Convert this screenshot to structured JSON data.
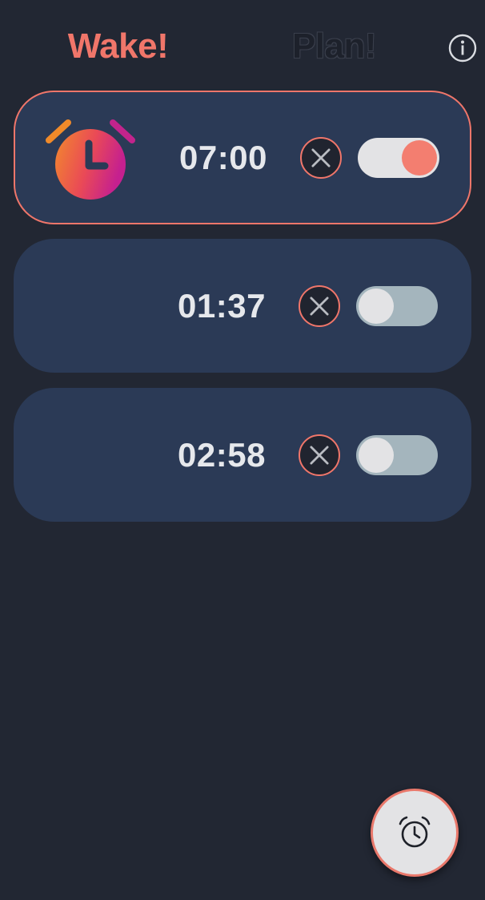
{
  "header": {
    "tabs": [
      {
        "label": "Wake!",
        "active": true
      },
      {
        "label": "Plan!",
        "active": false
      }
    ],
    "info_icon": "info-circle-icon"
  },
  "alarms": [
    {
      "time": "07:00",
      "enabled": true,
      "ringing_icon": "alarm-clock-icon",
      "delete_icon": "close-circle-icon"
    },
    {
      "time": "01:37",
      "enabled": false,
      "delete_icon": "close-circle-icon"
    },
    {
      "time": "02:58",
      "enabled": false,
      "delete_icon": "close-circle-icon"
    }
  ],
  "fab": {
    "icon": "alarm-add-icon"
  },
  "colors": {
    "background": "#222733",
    "card": "#2b3a56",
    "accent": "#f0766a",
    "toggle_on_track": "#e3e3e5",
    "toggle_off_track": "#a4b5bd",
    "time_text": "#e6e8ec"
  }
}
